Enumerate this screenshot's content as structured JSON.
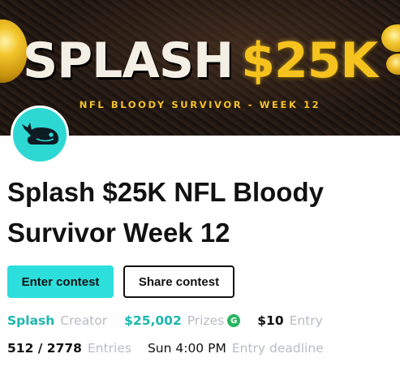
{
  "banner": {
    "title_word": "SPLASH",
    "title_amount": "$25K",
    "subtitle": "NFL BLOODY SURVIVOR - WEEK 12"
  },
  "contest": {
    "title_line1": "Splash $25K NFL Bloody",
    "title_line2": "Survivor Week 12"
  },
  "actions": {
    "enter_label": "Enter contest",
    "share_label": "Share contest"
  },
  "details": {
    "creator_name": "Splash",
    "creator_label": "Creator",
    "prize_amount": "$25,002",
    "prize_label": "Prizes",
    "prize_badge": "G",
    "entry_fee": "$10",
    "entry_label": "Entry",
    "entries_count": "512 / 2778",
    "entries_label": "Entries",
    "deadline_value": "Sun 4:00 PM",
    "deadline_label": "Entry deadline"
  },
  "colors": {
    "accent": "#2ddfdc",
    "banner_gold": "#f6c21d",
    "badge_green": "#28b561"
  }
}
